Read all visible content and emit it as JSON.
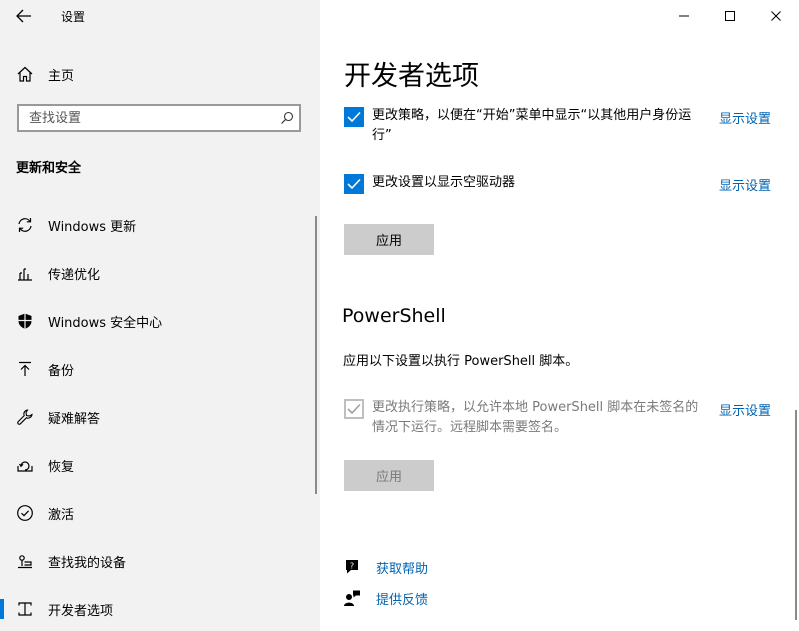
{
  "window": {
    "title": "设置"
  },
  "sidebar": {
    "home_label": "主页",
    "search_placeholder": "查找设置",
    "section_title": "更新和安全",
    "items": [
      {
        "label": "Windows 更新",
        "icon": "sync-icon"
      },
      {
        "label": "传递优化",
        "icon": "delivery-optimization-icon"
      },
      {
        "label": "Windows 安全中心",
        "icon": "shield-icon"
      },
      {
        "label": "备份",
        "icon": "backup-arrow-icon"
      },
      {
        "label": "疑难解答",
        "icon": "wrench-icon"
      },
      {
        "label": "恢复",
        "icon": "recovery-icon"
      },
      {
        "label": "激活",
        "icon": "check-circle-icon"
      },
      {
        "label": "查找我的设备",
        "icon": "find-device-icon"
      },
      {
        "label": "开发者选项",
        "icon": "developer-tools-icon",
        "selected": true
      }
    ]
  },
  "main": {
    "title": "开发者选项",
    "options": [
      {
        "text": "更改策略，以便在“开始”菜单中显示“以其他用户身份运行”",
        "checked": true,
        "disabled": false,
        "link": "显示设置"
      },
      {
        "text": "更改设置以显示空驱动器",
        "checked": true,
        "disabled": false,
        "link": "显示设置"
      }
    ],
    "apply_label": "应用",
    "powershell": {
      "title": "PowerShell",
      "description": "应用以下设置以执行 PowerShell 脚本。",
      "option": {
        "text": "更改执行策略，以允许本地 PowerShell 脚本在未签名的情况下运行。远程脚本需要签名。",
        "checked": true,
        "disabled": true,
        "link": "显示设置"
      },
      "apply_label": "应用"
    },
    "help": [
      {
        "label": "获取帮助",
        "icon": "help-chat-icon"
      },
      {
        "label": "提供反馈",
        "icon": "feedback-person-icon"
      }
    ]
  },
  "colors": {
    "accent": "#0078d7",
    "link": "#0063b1",
    "sidebar_bg": "#f2f2f2",
    "button_bg": "#cccccc"
  }
}
